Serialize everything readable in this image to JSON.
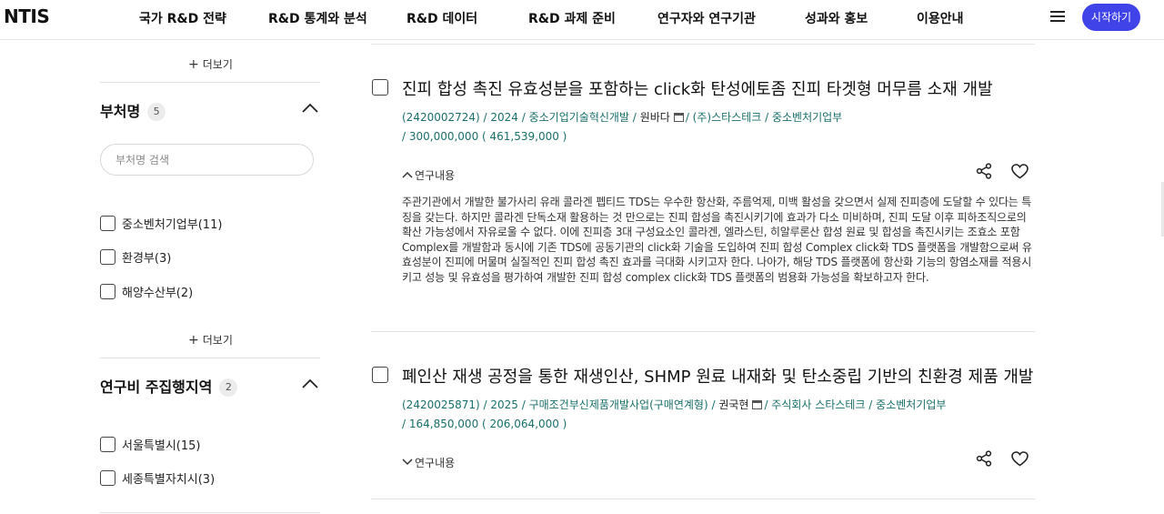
{
  "header": {
    "logo": "NTIS",
    "nav": [
      "국가 R&D 전략",
      "R&D 통계와 분석",
      "R&D 데이터",
      "R&D 과제 준비",
      "연구자와 연구기관",
      "성과와 홍보",
      "이용안내"
    ],
    "start_button": "시작하기"
  },
  "filters": {
    "more_label": "더보기",
    "ministry": {
      "title": "부처명",
      "count": "5",
      "search_placeholder": "부처명 검색",
      "options": [
        "중소벤처기업부(11)",
        "환경부(3)",
        "해양수산부(2)"
      ]
    },
    "region": {
      "title": "연구비 주집행지역",
      "count": "2",
      "options": [
        "서울특별시(15)",
        "세종특별자치시(3)"
      ]
    }
  },
  "results": [
    {
      "title": "진피 합성 촉진 유효성분을 포함하는 click화 탄성에토좀 진피 타겟형 머무름 소재 개발",
      "meta_prefix": "(2420002724) / 2024 / 중소기업기술혁신개발 /",
      "researcher": "원바다",
      "meta_suffix": "/ (주)스타스테크 / 중소벤처기업부",
      "budget": "/  300,000,000 ( 461,539,000 )",
      "toggle_label": "연구내용",
      "abstract": "주관기관에서 개발한 불가사리 유래 콜라겐 펩티드 TDS는 우수한 항산화, 주름억제, 미백 활성을 갖으면서 실제 진피층에 도달할 수 있다는 특징을 갖는다. 하지만 콜라겐 단독소재 활용하는 것 만으로는 진피 합성을 촉진시키기에 효과가 다소 미비하며, 진피 도달 이후 피하조직으로의 확산 가능성에서 자유로울 수 없다. 이에 진피층 3대 구성요소인 콜라겐, 엘라스틴, 히알루론산 합성 원료 및 합성을 촉진시키는 조효소 포함 Complex를 개발함과 동시에 기존 TDS에 공동기관의 click화 기술을 도입하여 진피 합성 Complex click화 TDS 플랫폼을 개발함으로써 유효성분이 진피에 머물며 실질적인 진피 합성 촉진 효과를 극대화 시키고자 한다. 나아가, 해당 TDS 플랫폼에 항산화 기능의 항염소재를 적용시키고 성능 및 유효성을 평가하여 개발한 진피 합성 complex click화 TDS 플랫폼의 범용화 가능성을 확보하고자 한다."
    },
    {
      "title": "폐인산 재생 공정을 통한 재생인산, SHMP 원료 내재화 및 탄소중립 기반의 친환경 제품 개발",
      "meta_prefix": "(2420025871) / 2025 / 구매조건부신제품개발사업(구매연계형) /",
      "researcher": "권국현",
      "meta_suffix": "/ 주식회사 스타스테크 / 중소벤처기업부",
      "budget": "/  164,850,000 ( 206,064,000 )",
      "toggle_label": "연구내용"
    }
  ],
  "colors": {
    "accent": "#3f43e8",
    "meta": "#1a6f6b"
  }
}
